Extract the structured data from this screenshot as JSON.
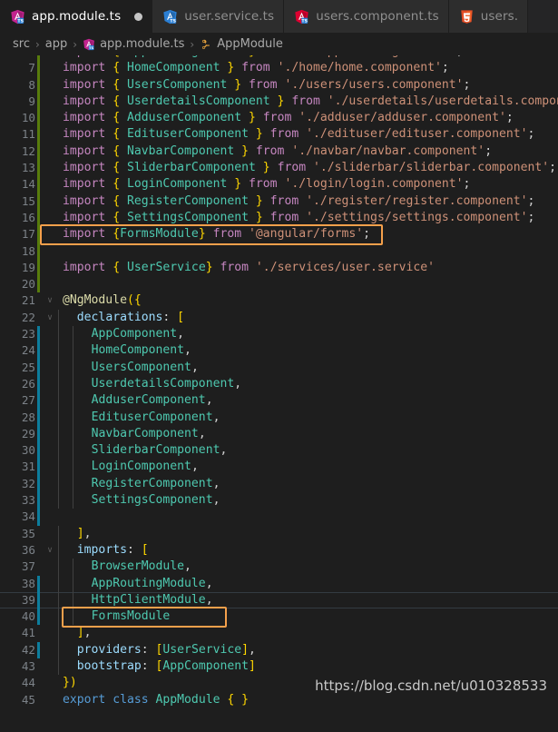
{
  "window": {
    "app": "Visual Studio Code",
    "theme_bg": "#1e1e1e",
    "accent_highlight": "#f5a04b"
  },
  "tabs": [
    {
      "label": "app.module.ts",
      "icon": "angular-ts-icon",
      "icon_color": "#c2238e",
      "active": true,
      "dirty": true
    },
    {
      "label": "user.service.ts",
      "icon": "angular-ts-icon",
      "icon_color": "#2b7fd4",
      "active": false,
      "dirty": false
    },
    {
      "label": "users.component.ts",
      "icon": "angular-ts-icon",
      "icon_color": "#dd0031",
      "active": false,
      "dirty": false
    },
    {
      "label": "users.",
      "icon": "html5-icon",
      "icon_color": "#e44d26",
      "active": false,
      "dirty": false
    }
  ],
  "breadcrumb": [
    {
      "label": "src",
      "icon": null
    },
    {
      "label": "app",
      "icon": null
    },
    {
      "label": "app.module.ts",
      "icon": "angular-ts-icon"
    },
    {
      "label": "AppModule",
      "icon": "module-symbol-icon"
    }
  ],
  "breadcrumb_separator": "›",
  "editor": {
    "language": "TypeScript",
    "first_visible_line": 6,
    "current_line": 39,
    "gutter_added_color": "#587c0c",
    "gutter_modified_color": "#0c7d9d",
    "lines": [
      {
        "n": 6,
        "text": "import { AppRoutingModule } from './app-routing.module';",
        "gutter": "added",
        "fold": "",
        "partial_top": true
      },
      {
        "n": 7,
        "text": "import { HomeComponent } from './home/home.component';",
        "gutter": "added",
        "fold": ""
      },
      {
        "n": 8,
        "text": "import { UsersComponent } from './users/users.component';",
        "gutter": "added",
        "fold": ""
      },
      {
        "n": 9,
        "text": "import { UserdetailsComponent } from './userdetails/userdetails.component';",
        "gutter": "added",
        "fold": ""
      },
      {
        "n": 10,
        "text": "import { AdduserComponent } from './adduser/adduser.component';",
        "gutter": "added",
        "fold": ""
      },
      {
        "n": 11,
        "text": "import { EdituserComponent } from './edituser/edituser.component';",
        "gutter": "added",
        "fold": ""
      },
      {
        "n": 12,
        "text": "import { NavbarComponent } from './navbar/navbar.component';",
        "gutter": "added",
        "fold": ""
      },
      {
        "n": 13,
        "text": "import { SliderbarComponent } from './sliderbar/sliderbar.component';",
        "gutter": "added",
        "fold": ""
      },
      {
        "n": 14,
        "text": "import { LoginComponent } from './login/login.component';",
        "gutter": "added",
        "fold": ""
      },
      {
        "n": 15,
        "text": "import { RegisterComponent } from './register/register.component';",
        "gutter": "added",
        "fold": ""
      },
      {
        "n": 16,
        "text": "import { SettingsComponent } from './settings/settings.component';",
        "gutter": "added",
        "fold": ""
      },
      {
        "n": 17,
        "text": "import {FormsModule} from '@angular/forms';",
        "gutter": "added",
        "fold": "",
        "highlighted": true
      },
      {
        "n": 18,
        "text": "",
        "gutter": "added",
        "fold": ""
      },
      {
        "n": 19,
        "text": "import { UserService} from './services/user.service'",
        "gutter": "added",
        "fold": ""
      },
      {
        "n": 20,
        "text": "",
        "gutter": "added",
        "fold": ""
      },
      {
        "n": 21,
        "text": "@NgModule({",
        "gutter": "none",
        "fold": "∨"
      },
      {
        "n": 22,
        "text": "  declarations: [",
        "gutter": "none",
        "fold": "∨"
      },
      {
        "n": 23,
        "text": "    AppComponent,",
        "gutter": "modified",
        "fold": ""
      },
      {
        "n": 24,
        "text": "    HomeComponent,",
        "gutter": "modified",
        "fold": ""
      },
      {
        "n": 25,
        "text": "    UsersComponent,",
        "gutter": "modified",
        "fold": ""
      },
      {
        "n": 26,
        "text": "    UserdetailsComponent,",
        "gutter": "modified",
        "fold": ""
      },
      {
        "n": 27,
        "text": "    AdduserComponent,",
        "gutter": "modified",
        "fold": ""
      },
      {
        "n": 28,
        "text": "    EdituserComponent,",
        "gutter": "modified",
        "fold": ""
      },
      {
        "n": 29,
        "text": "    NavbarComponent,",
        "gutter": "modified",
        "fold": ""
      },
      {
        "n": 30,
        "text": "    SliderbarComponent,",
        "gutter": "modified",
        "fold": ""
      },
      {
        "n": 31,
        "text": "    LoginComponent,",
        "gutter": "modified",
        "fold": ""
      },
      {
        "n": 32,
        "text": "    RegisterComponent,",
        "gutter": "modified",
        "fold": ""
      },
      {
        "n": 33,
        "text": "    SettingsComponent,",
        "gutter": "modified",
        "fold": ""
      },
      {
        "n": 34,
        "text": "",
        "gutter": "modified",
        "fold": ""
      },
      {
        "n": 35,
        "text": "  ],",
        "gutter": "none",
        "fold": ""
      },
      {
        "n": 36,
        "text": "  imports: [",
        "gutter": "none",
        "fold": "∨"
      },
      {
        "n": 37,
        "text": "    BrowserModule,",
        "gutter": "none",
        "fold": ""
      },
      {
        "n": 38,
        "text": "    AppRoutingModule,",
        "gutter": "modified",
        "fold": ""
      },
      {
        "n": 39,
        "text": "    HttpClientModule,",
        "gutter": "modified",
        "fold": "",
        "current": true
      },
      {
        "n": 40,
        "text": "    FormsModule",
        "gutter": "modified",
        "fold": "",
        "highlighted": true
      },
      {
        "n": 41,
        "text": "  ],",
        "gutter": "none",
        "fold": ""
      },
      {
        "n": 42,
        "text": "  providers: [UserService],",
        "gutter": "modified",
        "fold": ""
      },
      {
        "n": 43,
        "text": "  bootstrap: [AppComponent]",
        "gutter": "none",
        "fold": ""
      },
      {
        "n": 44,
        "text": "})",
        "gutter": "none",
        "fold": ""
      },
      {
        "n": 45,
        "text": "export class AppModule { }",
        "gutter": "none",
        "fold": "",
        "partial_bottom": true
      }
    ]
  },
  "watermark": {
    "text": "https://blog.csdn.net/u010328533"
  }
}
